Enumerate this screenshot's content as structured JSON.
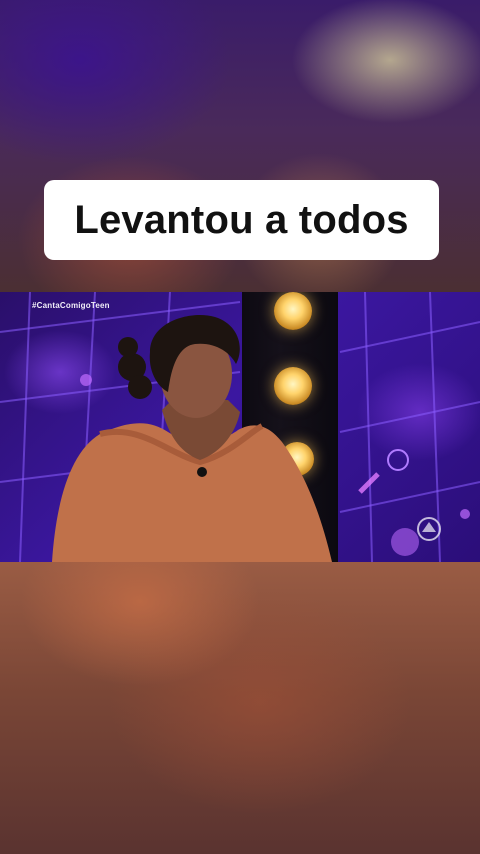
{
  "caption": {
    "text": "Levantou a todos"
  },
  "video": {
    "hashtag": "#CantaComigoTeen",
    "logo_icon": "broadcaster-logo-icon"
  },
  "colors": {
    "caption_bg": "#ffffff",
    "caption_text": "#111111",
    "stage_purple": "#3b17a0",
    "dress": "#c0714a"
  }
}
